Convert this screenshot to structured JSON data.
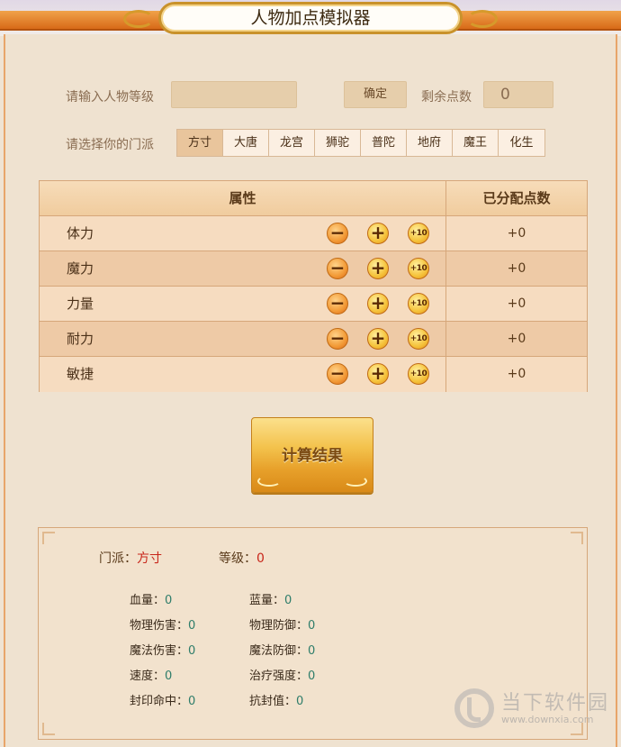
{
  "header": {
    "title": "人物加点模拟器"
  },
  "form": {
    "level_label": "请输入人物等级",
    "level_value": "",
    "confirm_label": "确定",
    "remaining_label": "剩余点数",
    "remaining_value": "0",
    "school_label": "请选择你的门派",
    "schools": [
      "方寸",
      "大唐",
      "龙宫",
      "狮驼",
      "普陀",
      "地府",
      "魔王",
      "化生"
    ],
    "selected_school": "方寸"
  },
  "attributes": {
    "header_attr": "属性",
    "header_points": "已分配点数",
    "rows": [
      {
        "name": "体力",
        "points": "+0"
      },
      {
        "name": "魔力",
        "points": "+0"
      },
      {
        "name": "力量",
        "points": "+0"
      },
      {
        "name": "耐力",
        "points": "+0"
      },
      {
        "name": "敏捷",
        "points": "+0"
      }
    ],
    "btn_minus": "−",
    "btn_plus": "+",
    "btn_plus10": "+10"
  },
  "calculate_label": "计算结果",
  "result": {
    "school_label": "门派：",
    "school_value": "方寸",
    "level_label": "等级：",
    "level_value": "0",
    "stats": [
      {
        "label": "血量：",
        "value": "0"
      },
      {
        "label": "蓝量：",
        "value": "0"
      },
      {
        "label": "物理伤害：",
        "value": "0"
      },
      {
        "label": "物理防御：",
        "value": "0"
      },
      {
        "label": "魔法伤害：",
        "value": "0"
      },
      {
        "label": "魔法防御：",
        "value": "0"
      },
      {
        "label": "速度：",
        "value": "0"
      },
      {
        "label": "治疗强度：",
        "value": "0"
      },
      {
        "label": "封印命中：",
        "value": "0"
      },
      {
        "label": "抗封值：",
        "value": "0"
      }
    ]
  },
  "watermark": {
    "text": "当下软件园",
    "url": "www.downxia.com"
  },
  "colors": {
    "accent_orange": "#d86a18",
    "highlight_red": "#c8261a",
    "value_green": "#2e7d6a"
  }
}
